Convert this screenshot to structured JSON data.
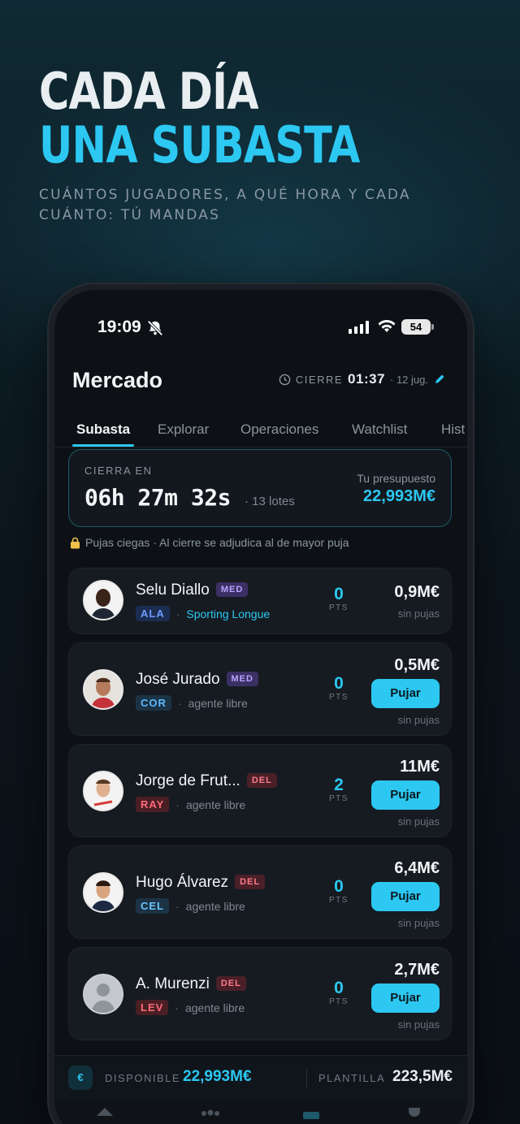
{
  "hero": {
    "line1": "CADA DÍA",
    "line2": "UNA SUBASTA",
    "subtitle": "CUÁNTOS JUGADORES, A QUÉ HORA Y CADA CUÁNTO: TÚ MANDAS"
  },
  "status_bar": {
    "time": "19:09",
    "battery": "54"
  },
  "header": {
    "title": "Mercado",
    "close_label": "CIERRE",
    "close_time": "01:37",
    "players_count": "· 12 jug."
  },
  "tabs": [
    "Subasta",
    "Explorar",
    "Operaciones",
    "Watchlist",
    "Hist"
  ],
  "timer": {
    "label": "CIERRA EN",
    "countdown": "06h 27m 32s",
    "lots": "· 13 lotes",
    "budget_label": "Tu presupuesto",
    "budget_value": "22,993M€"
  },
  "notice": "Pujas ciegas · Al cierre se adjudica al de mayor puja",
  "players": [
    {
      "name": "Selu Diallo",
      "position": "MED",
      "team": "ALA",
      "club": "Sporting Longue",
      "pts": "0",
      "pts_label": "PTS",
      "price": "0,9M€",
      "bid_status": "sin pujas"
    },
    {
      "name": "José Jurado",
      "position": "MED",
      "team": "COR",
      "club": "agente libre",
      "pts": "0",
      "pts_label": "PTS",
      "price": "0,5M€",
      "bid_label": "Pujar",
      "bid_status": "sin pujas"
    },
    {
      "name": "Jorge de Frut...",
      "position": "DEL",
      "team": "RAY",
      "club": "agente libre",
      "pts": "2",
      "pts_label": "PTS",
      "price": "11M€",
      "bid_label": "Pujar",
      "bid_status": "sin pujas"
    },
    {
      "name": "Hugo Álvarez",
      "position": "DEL",
      "team": "CEL",
      "club": "agente libre",
      "pts": "0",
      "pts_label": "PTS",
      "price": "6,4M€",
      "bid_label": "Pujar",
      "bid_status": "sin pujas"
    },
    {
      "name": "A. Murenzi",
      "position": "DEL",
      "team": "LEV",
      "club": "agente libre",
      "pts": "0",
      "pts_label": "PTS",
      "price": "2,7M€",
      "bid_label": "Pujar",
      "bid_status": "sin pujas"
    }
  ],
  "footer": {
    "currency_icon": "€",
    "available_label": "DISPONIBLE",
    "available_value": "22,993M€",
    "squad_label": "PLANTILLA",
    "squad_value": "223,5M€"
  },
  "colors": {
    "accent": "#2cc8f2",
    "background": "#0d1116",
    "card": "#161b21"
  }
}
